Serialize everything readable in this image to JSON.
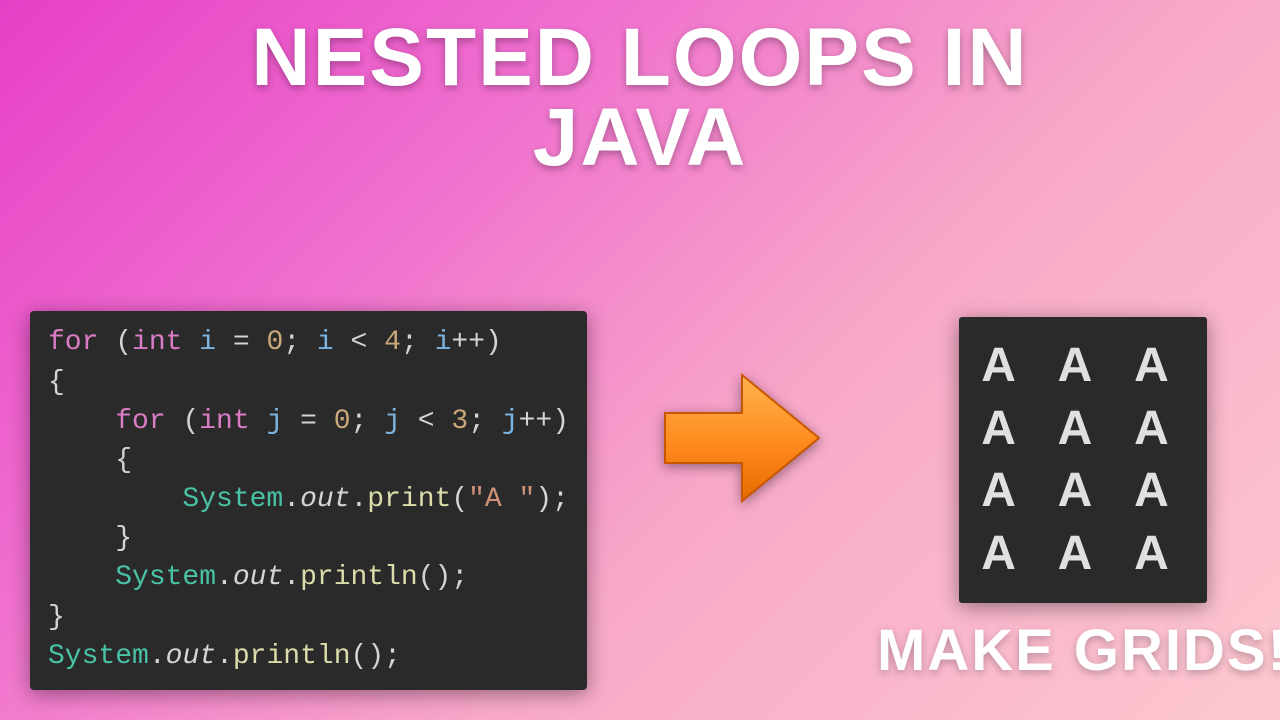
{
  "title_line1": "NESTED LOOPS IN",
  "title_line2": "JAVA",
  "subtitle": "MAKE GRIDS!",
  "code": {
    "l1_for": "for",
    "l1_lp": " (",
    "l1_int": "int",
    "l1_sp1": " ",
    "l1_i": "i",
    "l1_eq": " = ",
    "l1_zero": "0",
    "l1_semi1": "; ",
    "l1_i2": "i",
    "l1_lt": " < ",
    "l1_four": "4",
    "l1_semi2": "; ",
    "l1_i3": "i",
    "l1_pp": "++",
    "l1_rp": ")",
    "l2_ob": "{",
    "l3_ind": "    ",
    "l3_for": "for",
    "l3_lp": " (",
    "l3_int": "int",
    "l3_sp1": " ",
    "l3_j": "j",
    "l3_eq": " = ",
    "l3_zero": "0",
    "l3_semi1": "; ",
    "l3_j2": "j",
    "l3_lt": " < ",
    "l3_three": "3",
    "l3_semi2": "; ",
    "l3_j3": "j",
    "l3_pp": "++",
    "l3_rp": ")",
    "l4_ind": "    ",
    "l4_ob": "{",
    "l5_ind": "        ",
    "l5_sys": "System",
    "l5_dot1": ".",
    "l5_out": "out",
    "l5_dot2": ".",
    "l5_print": "print",
    "l5_lp": "(",
    "l5_str": "\"A \"",
    "l5_rp": ")",
    "l5_semi": ";",
    "l6_ind": "    ",
    "l6_cb": "}",
    "l7_ind": "    ",
    "l7_sys": "System",
    "l7_dot1": ".",
    "l7_out": "out",
    "l7_dot2": ".",
    "l7_println": "println",
    "l7_lp": "(",
    "l7_rp": ")",
    "l7_semi": ";",
    "l8_cb": "}",
    "l9_sys": "System",
    "l9_dot1": ".",
    "l9_out": "out",
    "l9_dot2": ".",
    "l9_println": "println",
    "l9_lp": "(",
    "l9_rp": ")",
    "l9_semi": ";"
  },
  "output": {
    "row1": "A A A",
    "row2": "A A A",
    "row3": "A A A",
    "row4": "A A A"
  }
}
